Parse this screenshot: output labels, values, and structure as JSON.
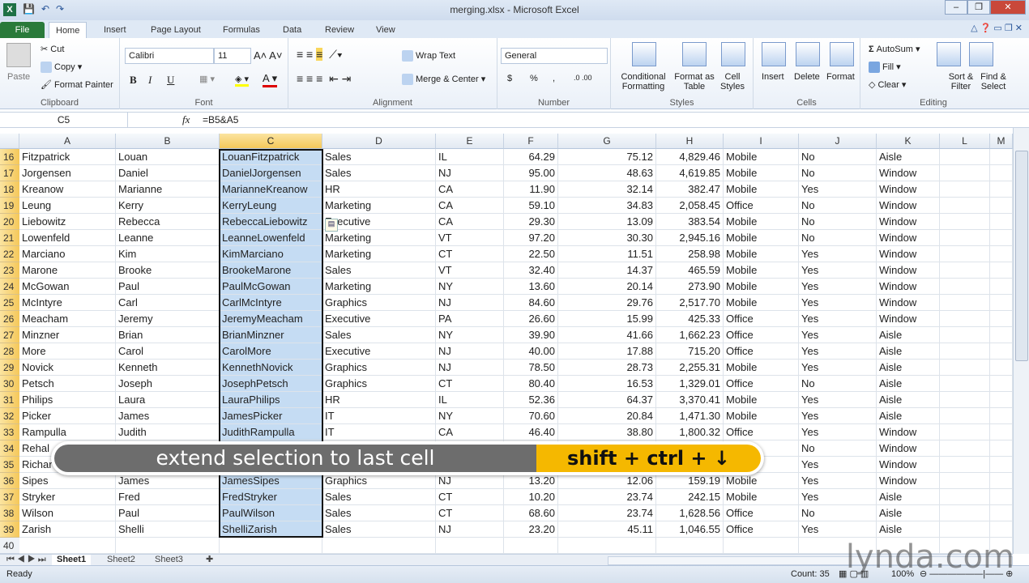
{
  "window": {
    "title": "merging.xlsx - Microsoft Excel",
    "minimize": "–",
    "restore": "❐",
    "close": "✕"
  },
  "ribbon_tabs": [
    "File",
    "Home",
    "Insert",
    "Page Layout",
    "Formulas",
    "Data",
    "Review",
    "View"
  ],
  "active_tab": "Home",
  "clipboard": {
    "paste": "Paste",
    "cut": "Cut",
    "copy": "Copy",
    "format_painter": "Format Painter",
    "label": "Clipboard"
  },
  "font": {
    "name": "Calibri",
    "size": "11",
    "bold": "B",
    "italic": "I",
    "underline": "U",
    "label": "Font"
  },
  "alignment": {
    "wrap_text": "Wrap Text",
    "merge_center": "Merge & Center",
    "label": "Alignment"
  },
  "number": {
    "format": "General",
    "currency": "$",
    "percent": "%",
    "comma": ",",
    "label": "Number"
  },
  "styles": {
    "conditional": "Conditional Formatting",
    "format_table": "Format as Table",
    "cell_styles": "Cell Styles",
    "label": "Styles"
  },
  "cells": {
    "insert": "Insert",
    "delete": "Delete",
    "format": "Format",
    "label": "Cells"
  },
  "editing": {
    "autosum": "AutoSum",
    "fill": "Fill",
    "clear": "Clear",
    "sort_filter": "Sort & Filter",
    "find_select": "Find & Select",
    "label": "Editing"
  },
  "formula_bar": {
    "name_box": "C5",
    "fx": "fx",
    "formula": "=B5&A5"
  },
  "columns": [
    "A",
    "B",
    "C",
    "D",
    "E",
    "F",
    "G",
    "H",
    "I",
    "J",
    "K",
    "L",
    "M"
  ],
  "selected_column": "C",
  "rows": [
    {
      "n": "16",
      "c": [
        "Fitzpatrick",
        "Louan",
        "LouanFitzpatrick",
        "Sales",
        "IL",
        "64.29",
        "75.12",
        "4,829.46",
        "Mobile",
        "No",
        "Aisle"
      ]
    },
    {
      "n": "17",
      "c": [
        "Jorgensen",
        "Daniel",
        "DanielJorgensen",
        "Sales",
        "NJ",
        "95.00",
        "48.63",
        "4,619.85",
        "Mobile",
        "No",
        "Window"
      ]
    },
    {
      "n": "18",
      "c": [
        "Kreanow",
        "Marianne",
        "MarianneKreanow",
        "HR",
        "CA",
        "11.90",
        "32.14",
        "382.47",
        "Mobile",
        "Yes",
        "Window"
      ]
    },
    {
      "n": "19",
      "c": [
        "Leung",
        "Kerry",
        "KerryLeung",
        "Marketing",
        "CA",
        "59.10",
        "34.83",
        "2,058.45",
        "Office",
        "No",
        "Window"
      ]
    },
    {
      "n": "20",
      "c": [
        "Liebowitz",
        "Rebecca",
        "RebeccaLiebowitz",
        "Executive",
        "CA",
        "29.30",
        "13.09",
        "383.54",
        "Mobile",
        "No",
        "Window"
      ]
    },
    {
      "n": "21",
      "c": [
        "Lowenfeld",
        "Leanne",
        "LeanneLowenfeld",
        "Marketing",
        "VT",
        "97.20",
        "30.30",
        "2,945.16",
        "Mobile",
        "No",
        "Window"
      ]
    },
    {
      "n": "22",
      "c": [
        "Marciano",
        "Kim",
        "KimMarciano",
        "Marketing",
        "CT",
        "22.50",
        "11.51",
        "258.98",
        "Mobile",
        "Yes",
        "Window"
      ]
    },
    {
      "n": "23",
      "c": [
        "Marone",
        "Brooke",
        "BrookeMarone",
        "Sales",
        "VT",
        "32.40",
        "14.37",
        "465.59",
        "Mobile",
        "Yes",
        "Window"
      ]
    },
    {
      "n": "24",
      "c": [
        "McGowan",
        "Paul",
        "PaulMcGowan",
        "Marketing",
        "NY",
        "13.60",
        "20.14",
        "273.90",
        "Mobile",
        "Yes",
        "Window"
      ]
    },
    {
      "n": "25",
      "c": [
        "McIntyre",
        "Carl",
        "CarlMcIntyre",
        "Graphics",
        "NJ",
        "84.60",
        "29.76",
        "2,517.70",
        "Mobile",
        "Yes",
        "Window"
      ]
    },
    {
      "n": "26",
      "c": [
        "Meacham",
        "Jeremy",
        "JeremyMeacham",
        "Executive",
        "PA",
        "26.60",
        "15.99",
        "425.33",
        "Office",
        "Yes",
        "Window"
      ]
    },
    {
      "n": "27",
      "c": [
        "Minzner",
        "Brian",
        "BrianMinzner",
        "Sales",
        "NY",
        "39.90",
        "41.66",
        "1,662.23",
        "Office",
        "Yes",
        "Aisle"
      ]
    },
    {
      "n": "28",
      "c": [
        "More",
        "Carol",
        "CarolMore",
        "Executive",
        "NJ",
        "40.00",
        "17.88",
        "715.20",
        "Office",
        "Yes",
        "Aisle"
      ]
    },
    {
      "n": "29",
      "c": [
        "Novick",
        "Kenneth",
        "KennethNovick",
        "Graphics",
        "NJ",
        "78.50",
        "28.73",
        "2,255.31",
        "Mobile",
        "Yes",
        "Aisle"
      ]
    },
    {
      "n": "30",
      "c": [
        "Petsch",
        "Joseph",
        "JosephPetsch",
        "Graphics",
        "CT",
        "80.40",
        "16.53",
        "1,329.01",
        "Office",
        "No",
        "Aisle"
      ]
    },
    {
      "n": "31",
      "c": [
        "Philips",
        "Laura",
        "LauraPhilips",
        "HR",
        "IL",
        "52.36",
        "64.37",
        "3,370.41",
        "Mobile",
        "Yes",
        "Aisle"
      ]
    },
    {
      "n": "32",
      "c": [
        "Picker",
        "James",
        "JamesPicker",
        "IT",
        "NY",
        "70.60",
        "20.84",
        "1,471.30",
        "Mobile",
        "Yes",
        "Aisle"
      ]
    },
    {
      "n": "33",
      "c": [
        "Rampulla",
        "Judith",
        "JudithRampulla",
        "IT",
        "CA",
        "46.40",
        "38.80",
        "1,800.32",
        "Office",
        "Yes",
        "Window"
      ]
    },
    {
      "n": "34",
      "c": [
        "Rehal",
        "",
        "",
        "",
        "",
        "",
        "",
        "",
        "",
        "No",
        "Window"
      ]
    },
    {
      "n": "35",
      "c": [
        "Richar",
        "",
        "",
        "",
        "",
        "",
        "",
        "",
        "",
        "Yes",
        "Window"
      ]
    },
    {
      "n": "36",
      "c": [
        "Sipes",
        "James",
        "JamesSipes",
        "Graphics",
        "NJ",
        "13.20",
        "12.06",
        "159.19",
        "Mobile",
        "Yes",
        "Window"
      ]
    },
    {
      "n": "37",
      "c": [
        "Stryker",
        "Fred",
        "FredStryker",
        "Sales",
        "CT",
        "10.20",
        "23.74",
        "242.15",
        "Mobile",
        "Yes",
        "Aisle"
      ]
    },
    {
      "n": "38",
      "c": [
        "Wilson",
        "Paul",
        "PaulWilson",
        "Sales",
        "CT",
        "68.60",
        "23.74",
        "1,628.56",
        "Office",
        "No",
        "Aisle"
      ]
    },
    {
      "n": "39",
      "c": [
        "Zarish",
        "Shelli",
        "ShelliZarish",
        "Sales",
        "NJ",
        "23.20",
        "45.11",
        "1,046.55",
        "Office",
        "Yes",
        "Aisle"
      ]
    },
    {
      "n": "40",
      "c": [
        "",
        "",
        "",
        "",
        "",
        "",
        "",
        "",
        "",
        "",
        ""
      ]
    }
  ],
  "sheets": [
    "Sheet1",
    "Sheet2",
    "Sheet3"
  ],
  "active_sheet": "Sheet1",
  "status": {
    "ready": "Ready",
    "count": "Count: 35",
    "zoom": "100%"
  },
  "overlay": {
    "action": "extend selection to last cell",
    "shortcut": "shift + ctrl + ↓"
  },
  "watermark": "lynda.com",
  "colors": {
    "selection": "#c5dcf3",
    "header_selected": "#f5c85a",
    "overlay_accent": "#f5b800",
    "file_tab": "#2a7a3a"
  }
}
